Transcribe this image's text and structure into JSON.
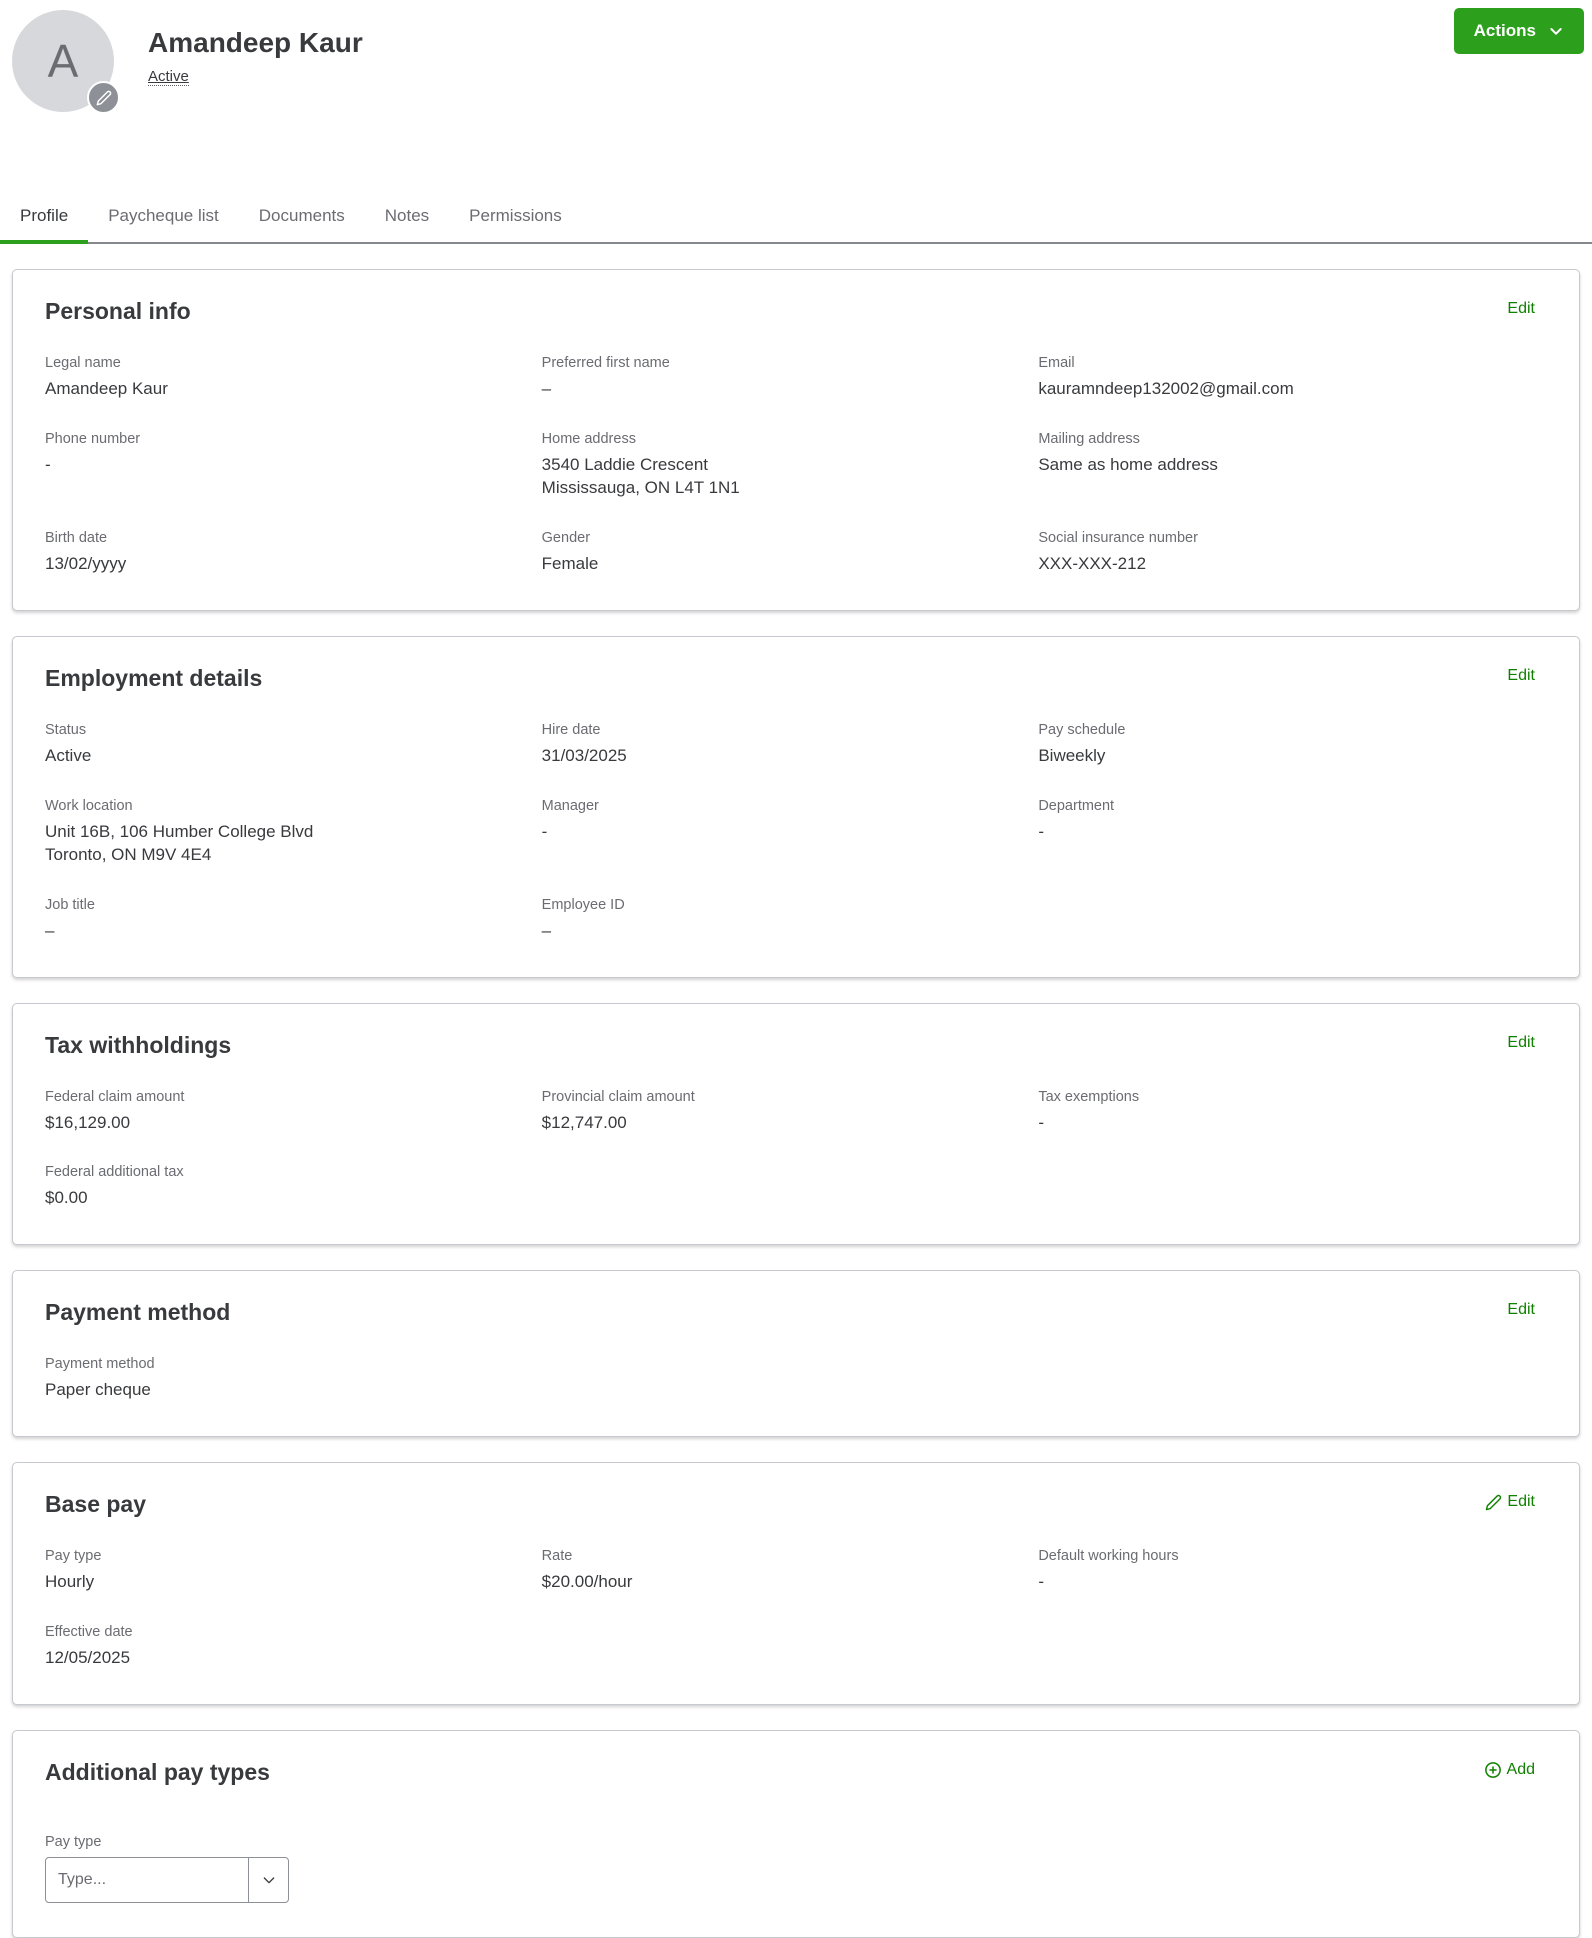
{
  "header": {
    "avatar_initial": "A",
    "name": "Amandeep Kaur",
    "status_link": "Active",
    "actions_label": "Actions"
  },
  "tabs": [
    {
      "label": "Profile",
      "active": true
    },
    {
      "label": "Paycheque list",
      "active": false
    },
    {
      "label": "Documents",
      "active": false
    },
    {
      "label": "Notes",
      "active": false
    },
    {
      "label": "Permissions",
      "active": false
    }
  ],
  "personal": {
    "title": "Personal info",
    "edit": "Edit",
    "fields": [
      {
        "label": "Legal name",
        "value": "Amandeep Kaur"
      },
      {
        "label": "Preferred first name",
        "value": "–"
      },
      {
        "label": "Email",
        "value": "kauramndeep132002@gmail.com"
      },
      {
        "label": "Phone number",
        "value": "-"
      },
      {
        "label": "Home address",
        "value": "3540 Laddie Crescent\nMississauga, ON L4T 1N1"
      },
      {
        "label": "Mailing address",
        "value": "Same as home address"
      },
      {
        "label": "Birth date",
        "value": "13/02/yyyy"
      },
      {
        "label": "Gender",
        "value": "Female"
      },
      {
        "label": "Social insurance number",
        "value": "XXX-XXX-212"
      }
    ]
  },
  "employment": {
    "title": "Employment details",
    "edit": "Edit",
    "fields": [
      {
        "label": "Status",
        "value": "Active"
      },
      {
        "label": "Hire date",
        "value": "31/03/2025"
      },
      {
        "label": "Pay schedule",
        "value": "Biweekly"
      },
      {
        "label": "Work location",
        "value": "Unit 16B, 106 Humber College Blvd\nToronto, ON M9V 4E4"
      },
      {
        "label": "Manager",
        "value": "-"
      },
      {
        "label": "Department",
        "value": "-"
      },
      {
        "label": "Job title",
        "value": "–"
      },
      {
        "label": "Employee ID",
        "value": "–"
      }
    ]
  },
  "tax": {
    "title": "Tax withholdings",
    "edit": "Edit",
    "fields": [
      {
        "label": "Federal claim amount",
        "value": "$16,129.00"
      },
      {
        "label": "Provincial claim amount",
        "value": "$12,747.00"
      },
      {
        "label": "Tax exemptions",
        "value": "-"
      },
      {
        "label": "Federal additional tax",
        "value": "$0.00"
      }
    ]
  },
  "payment": {
    "title": "Payment method",
    "edit": "Edit",
    "fields": [
      {
        "label": "Payment method",
        "value": "Paper cheque"
      }
    ]
  },
  "basepay": {
    "title": "Base pay",
    "edit": "Edit",
    "fields": [
      {
        "label": "Pay type",
        "value": "Hourly"
      },
      {
        "label": "Rate",
        "value": "$20.00/hour"
      },
      {
        "label": "Default working hours",
        "value": "-"
      },
      {
        "label": "Effective date",
        "value": "12/05/2025"
      }
    ]
  },
  "additional": {
    "title": "Additional pay types",
    "add": "Add",
    "paytype_label": "Pay type",
    "select_placeholder": "Type..."
  },
  "colors": {
    "accent_green": "#2ca01c",
    "link_green": "#108000",
    "text_dark": "#393a3d",
    "text_gray": "#6b6c72"
  }
}
